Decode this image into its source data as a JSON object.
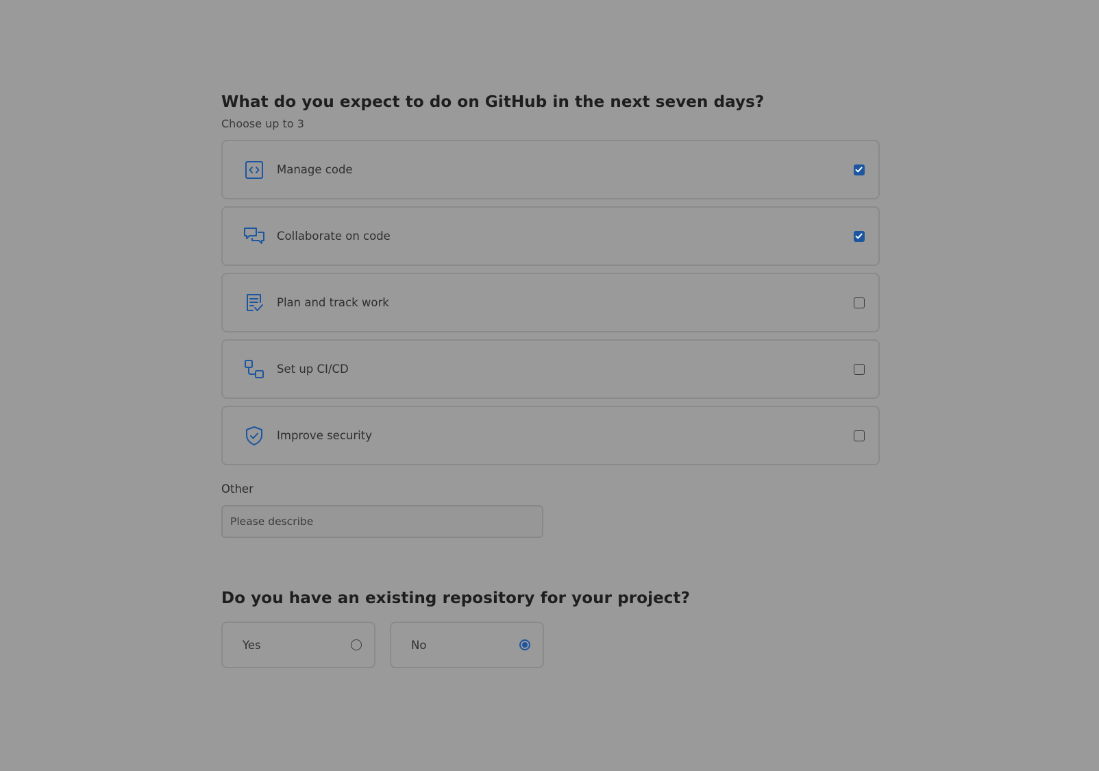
{
  "question1": {
    "title": "What do you expect to do on GitHub in the next seven days?",
    "subtitle": "Choose up to 3",
    "options": [
      {
        "label": "Manage code",
        "icon": "code-square-icon",
        "checked": true
      },
      {
        "label": "Collaborate on code",
        "icon": "comment-discussion-icon",
        "checked": true
      },
      {
        "label": "Plan and track work",
        "icon": "tasklist-icon",
        "checked": false
      },
      {
        "label": "Set up CI/CD",
        "icon": "workflow-icon",
        "checked": false
      },
      {
        "label": "Improve security",
        "icon": "shield-check-icon",
        "checked": false
      }
    ]
  },
  "other": {
    "label": "Other",
    "placeholder": "Please describe",
    "value": ""
  },
  "question2": {
    "title": "Do you have an existing repository for your project?",
    "options": [
      {
        "label": "Yes",
        "selected": false
      },
      {
        "label": "No",
        "selected": true
      }
    ]
  },
  "colors": {
    "accent": "#1d56a0",
    "background": "#9a9a9a"
  }
}
